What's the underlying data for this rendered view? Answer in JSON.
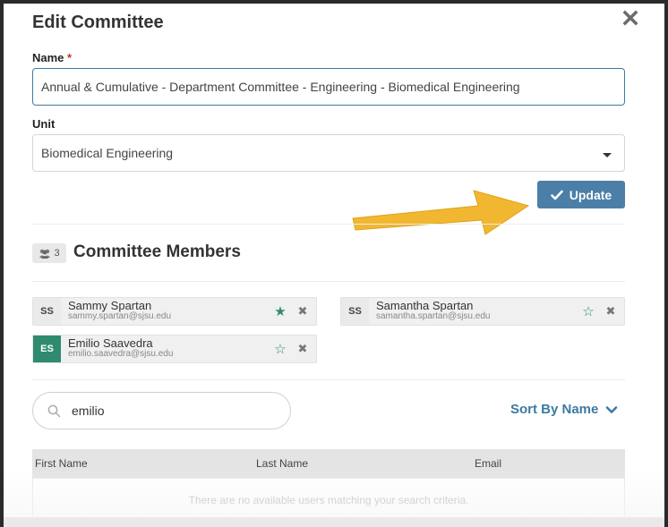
{
  "dialog": {
    "title": "Edit Committee",
    "close_icon": "close-icon"
  },
  "form": {
    "name_label": "Name",
    "required_mark": "*",
    "name_value": "Annual & Cumulative - Department Committee - Engineering - Biomedical Engineering",
    "unit_label": "Unit",
    "unit_value": "Biomedical Engineering",
    "update_label": "Update"
  },
  "members": {
    "count": "3",
    "title": "Committee Members",
    "list": [
      {
        "initials": "SS",
        "name": "Sammy Spartan",
        "email": "sammy.spartan@sjsu.edu",
        "starred": true
      },
      {
        "initials": "SS",
        "name": "Samantha Spartan",
        "email": "samantha.spartan@sjsu.edu",
        "starred": false
      },
      {
        "initials": "ES",
        "name": "Emilio Saavedra",
        "email": "emilio.saavedra@sjsu.edu",
        "starred": false
      }
    ]
  },
  "search": {
    "value": "emilio",
    "sort_label": "Sort By Name"
  },
  "table": {
    "columns": [
      "First Name",
      "Last Name",
      "Email"
    ],
    "empty_message": "There are no available users matching your search criteria."
  },
  "colors": {
    "accent": "#4b7fa8",
    "avatar_green": "#2e8b6f",
    "annotation_arrow": "#f2b731"
  }
}
